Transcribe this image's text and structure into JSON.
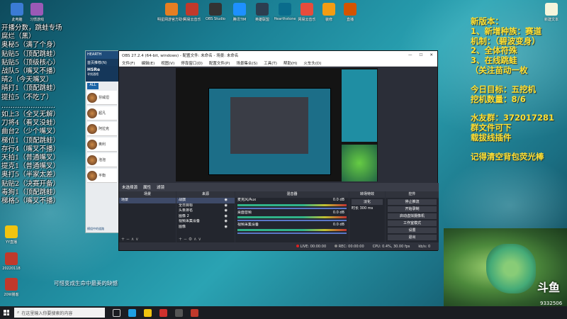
{
  "desktop_icons_top": [
    {
      "label": "此电脑",
      "color": "#3b7bd4"
    },
    {
      "label": "习惯游戏",
      "color": "#9b59b6"
    },
    {
      "label": "明星网游官方助手",
      "color": "#e67e22"
    },
    {
      "label": "网易云音乐",
      "color": "#c0392b"
    },
    {
      "label": "OBS Studio",
      "color": "#333333"
    },
    {
      "label": "腾讯TIM",
      "color": "#1e90ff"
    },
    {
      "label": "英雄联盟",
      "color": "#2c3e50"
    },
    {
      "label": "Hearthstone",
      "color": "#0a6c8c"
    },
    {
      "label": "网易云音乐",
      "color": "#e74c3c"
    },
    {
      "label": "装修",
      "color": "#f39c12"
    },
    {
      "label": "直播",
      "color": "#d35400"
    }
  ],
  "desktop_icons_left": [
    {
      "label": "YY直播",
      "color": "#f1c40f"
    },
    {
      "label": "20220118",
      "color": "#c0392b"
    },
    {
      "label": "20W播客",
      "color": "#c0392b"
    }
  ],
  "desktop_icon_right": {
    "label": "新建文本",
    "color": "#f5f5dc"
  },
  "left_list": {
    "title": "开播分数，跳蛙专场",
    "lines": [
      "腐烂（黑）",
      "奥秘5（满了个身）",
      "贴贴5（顶配跳蛙）",
      "贴贴5（顶级核心）",
      "战队5（嘴叉不播）",
      "晴2（今天嘴叉）",
      "晴打1（顶配跳蛙）",
      "提拉5（不吃了）",
      "……………………",
      "如上3（全叉无解）",
      "刀将4（看叉没蛙）",
      "曲台2（少个嘴叉）",
      "梯位1（顶配跳蛙）",
      "存行4（嘴叉不播）",
      "天拍1（普通嘴叉）",
      "提克1（普通嘴叉）",
      "奥打5（半家太差）",
      "贴贴2（决赛开备）",
      "毒狗1（顶配跳蛙）",
      "梯格5（嘴叉不播）"
    ]
  },
  "right_info": {
    "lines_a": [
      "新版本：",
      "1、新增种族：赛道",
      "机制：（碧波变身）",
      "2、全体符殊",
      "3、在线跳蛙",
      "（关注苗动一枚"
    ],
    "lines_b": [
      "今日目标：五挖机",
      "挖机数量：8/6"
    ],
    "lines_c": [
      "水友群：372017281",
      "群文件可下",
      "载拔线插件"
    ],
    "lines_d": [
      "记得清空背包荧光棒"
    ]
  },
  "hearth": {
    "title": "HEARTH",
    "nav": "首页推荐(N)",
    "brand": "HSRe",
    "sub": "寻找酒馆",
    "filter": "ALL",
    "cards": [
      "芬威坦",
      "超凡",
      "阿拉克",
      "奥利",
      "泡泡",
      "平衡"
    ],
    "footer": "模组中的道路"
  },
  "obs": {
    "title": "OBS 27.2.4 (64-bit, windows) - 配置文件: 未命名 - 场景: 未命名",
    "menu": [
      "文件(F)",
      "编辑(E)",
      "视图(V)",
      "停靠窗口(D)",
      "配置文件(P)",
      "场景集合(S)",
      "工具(T)",
      "帮助(H)",
      "火车头(D)"
    ],
    "scene_bar": [
      "未选择源",
      "属性",
      "滤镜"
    ],
    "docks": {
      "scenes": {
        "header": "场景",
        "items": [
          "场景"
        ]
      },
      "sources": {
        "header": "来源",
        "items": [
          "战旗",
          "全日目标",
          "头条排名",
          "图像 2",
          "视频采集设备",
          "图像"
        ]
      },
      "mixer": {
        "header": "混音器",
        "tracks": [
          {
            "name": "麦克风/Aux",
            "db": "0.0 dB"
          },
          {
            "name": "桌面音频",
            "db": "0.0 dB"
          },
          {
            "name": "视频采集设备",
            "db": "0.0 dB"
          }
        ]
      },
      "transitions": {
        "header": "转场特效",
        "type": "淡化",
        "duration_label": "时长",
        "duration": "300 ms"
      },
      "controls": {
        "header": "控件",
        "buttons": [
          "停止推流",
          "开始录制",
          "启动虚拟摄像机",
          "工作室模式",
          "设置",
          "退出"
        ]
      }
    },
    "status": {
      "live": "LIVE: 00:00:00",
      "rec": "REC: 00:00:00",
      "cpu": "CPU: 0.4%, 30.00 fps",
      "kbps": "kb/s: 0"
    }
  },
  "cam": {
    "brand": "斗鱼",
    "number": "9332506"
  },
  "tagline": "可惜变成生命中最美的缺憾",
  "taskbar": {
    "search_placeholder": "在这里输入你要搜索的内容",
    "apps": [
      {
        "name": "task-view-icon",
        "color": "#cccccc"
      },
      {
        "name": "edge-icon",
        "color": "#1fa0e4"
      },
      {
        "name": "explorer-icon",
        "color": "#f1c40f"
      },
      {
        "name": "netease-icon",
        "color": "#d0312d"
      },
      {
        "name": "obs-icon",
        "color": "#555555"
      },
      {
        "name": "record-icon",
        "color": "#c0392b"
      }
    ]
  }
}
